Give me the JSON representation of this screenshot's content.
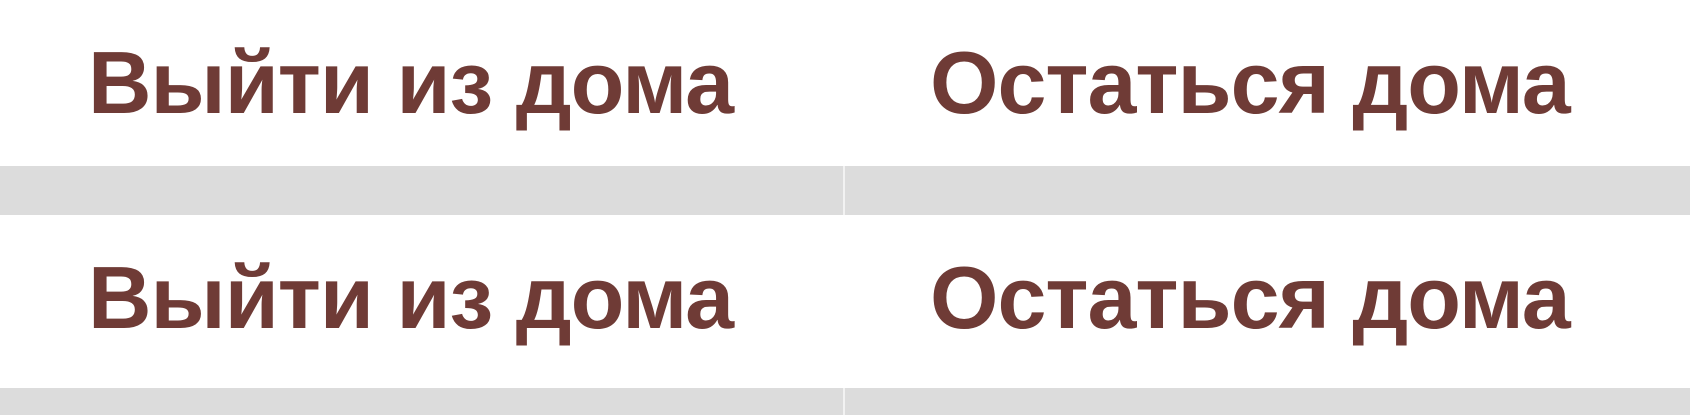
{
  "rows": [
    {
      "left_option": "Выйти из дома",
      "right_option": "Остаться дома"
    },
    {
      "left_option": "Выйти из дома",
      "right_option": "Остаться дома"
    }
  ],
  "colors": {
    "text": "#6f3b36",
    "separator": "#dcdcdc",
    "background": "#ffffff"
  }
}
